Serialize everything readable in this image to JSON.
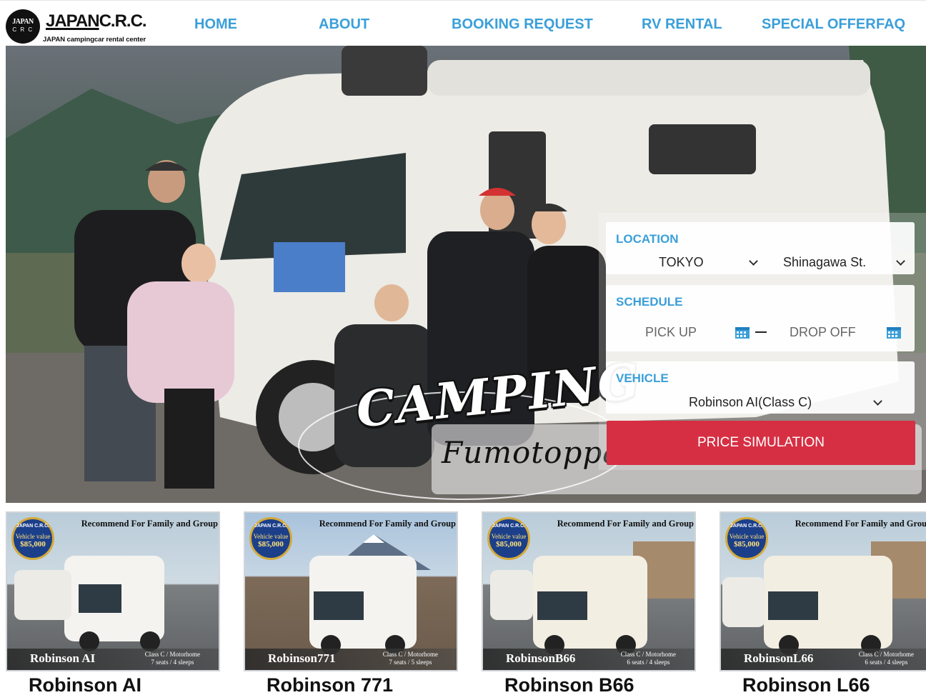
{
  "brand": {
    "badge_top": "JAPAN",
    "badge_bottom": "C R C",
    "word_a": "JAPAN",
    "word_b": "C.R.C.",
    "subtitle": "JAPAN campingcar rental center"
  },
  "nav": {
    "home": "HOME",
    "about": "ABOUT",
    "booking": "BOOKING REQUEST",
    "rv_rental": "RV RENTAL",
    "special_offer": "SPECIAL OFFER",
    "faq": "FAQ"
  },
  "hero": {
    "title": "CAMPING",
    "subtitle": "Fumotoppa"
  },
  "form": {
    "location_label": "LOCATION",
    "location_city": "TOKYO",
    "location_station": "Shinagawa St.",
    "schedule_label": "SCHEDULE",
    "pickup_placeholder": "PICK UP",
    "dropoff_placeholder": "DROP OFF",
    "vehicle_label": "VEHICLE",
    "vehicle_value": "Robinson AI(Class C)",
    "simulate_button": "PRICE SIMULATION"
  },
  "cards": [
    {
      "recommend": "Recommend For Family and Group",
      "badge_brand": "JAPAN C.R.C.",
      "badge_label": "Vehicle value",
      "badge_value": "$85,000",
      "strip_name": "Robinson AI",
      "class_line": "Class C / Motorhome",
      "seats_line": "7 seats / 4 sleeps",
      "title": "Robinson AI"
    },
    {
      "recommend": "Recommend For Family and Group",
      "badge_brand": "JAPAN C.R.C.",
      "badge_label": "Vehicle value",
      "badge_value": "$85,000",
      "strip_name": "Robinson771",
      "class_line": "Class C / Motorhome",
      "seats_line": "7 seats / 5 sleeps",
      "title": "Robinson 771"
    },
    {
      "recommend": "Recommend For Family and Group",
      "badge_brand": "JAPAN C.R.C.",
      "badge_label": "Vehicle value",
      "badge_value": "$85,000",
      "strip_name": "RobinsonB66",
      "class_line": "Class C / Motorhome",
      "seats_line": "6 seats / 4 sleeps",
      "title": "Robinson B66"
    },
    {
      "recommend": "Recommend For Family and Group",
      "badge_brand": "JAPAN C.R.C.",
      "badge_label": "Vehicle value",
      "badge_value": "$85,000",
      "strip_name": "RobinsonL66",
      "class_line": "Class C / Motorhome",
      "seats_line": "6 seats / 4 sleeps",
      "title": "Robinson L66"
    }
  ],
  "colors": {
    "nav_blue": "#3a9fd9",
    "button_red": "#d62f43",
    "badge_navy": "#1c3f8a",
    "badge_gold": "#d4aa3a"
  }
}
